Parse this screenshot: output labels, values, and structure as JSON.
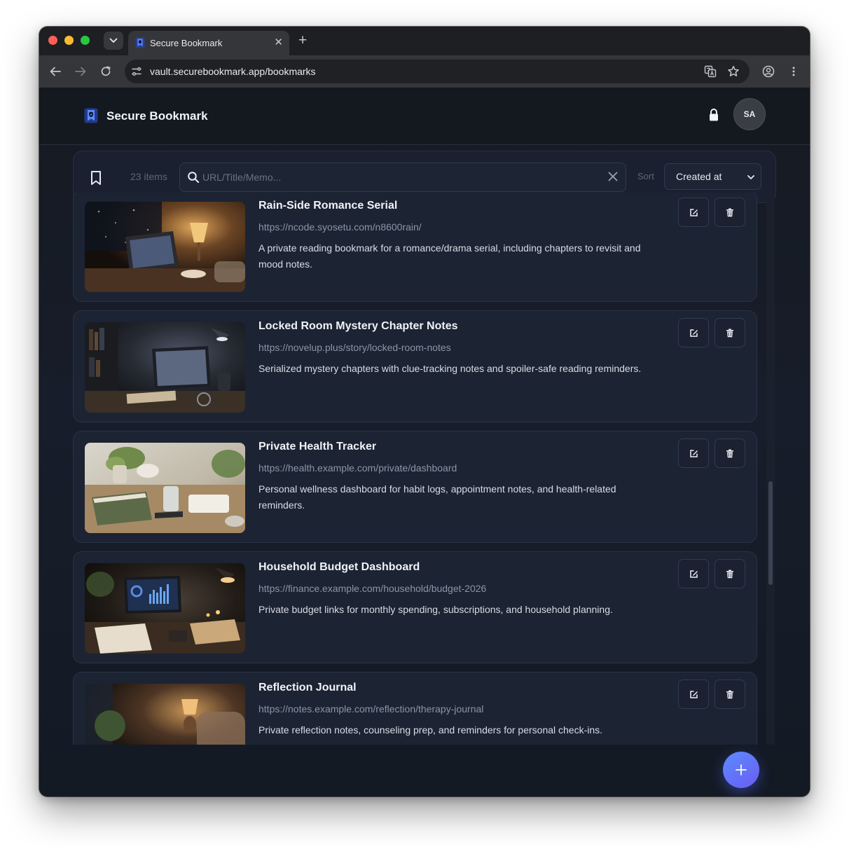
{
  "browser": {
    "tab_title": "Secure Bookmark",
    "url": "vault.securebookmark.app/bookmarks",
    "icons": [
      "back-icon",
      "forward-icon",
      "reload-icon",
      "site-settings-icon",
      "translate-icon",
      "star-icon",
      "profile-icon",
      "menu-icon"
    ]
  },
  "header": {
    "app_name": "Secure Bookmark",
    "avatar_initials": "SA"
  },
  "toolbar": {
    "count_label": "23 items",
    "search_placeholder": "URL/Title/Memo...",
    "search_value": "",
    "sort_label": "Sort",
    "sort_value": "Created at"
  },
  "bookmarks": [
    {
      "title": "Rain-Side Romance Serial",
      "url": "https://ncode.syosetu.com/n8600rain/",
      "memo": "A private reading bookmark for a romance/drama serial, including chapters to revisit and mood notes."
    },
    {
      "title": "Locked Room Mystery Chapter Notes",
      "url": "https://novelup.plus/story/locked-room-notes",
      "memo": "Serialized mystery chapters with clue-tracking notes and spoiler-safe reading reminders."
    },
    {
      "title": "Private Health Tracker",
      "url": "https://health.example.com/private/dashboard",
      "memo": "Personal wellness dashboard for habit logs, appointment notes, and health-related reminders."
    },
    {
      "title": "Household Budget Dashboard",
      "url": "https://finance.example.com/household/budget-2026",
      "memo": "Private budget links for monthly spending, subscriptions, and household planning."
    },
    {
      "title": "Reflection Journal",
      "url": "https://notes.example.com/reflection/therapy-journal",
      "memo": "Private reflection notes, counseling prep, and reminders for personal check-ins."
    }
  ],
  "colors": {
    "accent": "#5b8cff",
    "background": "#161a22",
    "card": "#1c2333"
  }
}
